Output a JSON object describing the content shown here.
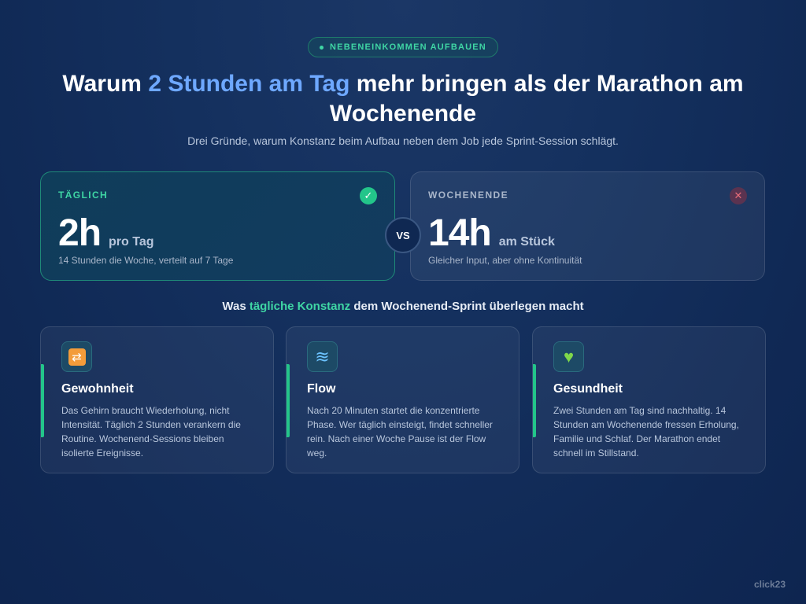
{
  "badge": {
    "label": "NEBENEINKOMMEN AUFBAUEN"
  },
  "headline": {
    "part1": "Warum ",
    "highlight": "2 Stunden am Tag",
    "part2": " mehr bringen als der Marathon am Wochenende"
  },
  "subtitle": "Drei Gründe, warum Konstanz beim Aufbau neben dem Job jede Sprint-Session schlägt.",
  "comparison": {
    "left": {
      "label": "TÄGLICH",
      "status_icon": "check-icon",
      "status_glyph": "✓",
      "value": "2h",
      "unit": "pro Tag",
      "description": "14 Stunden die Woche, verteilt auf 7 Tage",
      "accent_color": "#3fd6a4"
    },
    "vs_label": "VS",
    "right": {
      "label": "WOCHENENDE",
      "status_icon": "close-icon",
      "status_glyph": "✕",
      "value": "14h",
      "unit": "am Stück",
      "description": "Gleicher Input, aber ohne Kontinuität",
      "accent_color": "#e86d7a"
    }
  },
  "section": {
    "part1": "Was ",
    "highlight": "tägliche Konstanz",
    "part2": " dem Wochenend-Sprint überlegen macht"
  },
  "features": [
    {
      "icon": "repeat-icon",
      "glyph": "🔁",
      "title": "Gewohnheit",
      "text": "Das Gehirn braucht Wiederholung, nicht Intensität. Täglich 2 Stunden verankern die Routine. Wochenend-Sessions bleiben isolierte Ereignisse."
    },
    {
      "icon": "wave-icon",
      "glyph": "🌊",
      "title": "Flow",
      "text": "Nach 20 Minuten startet die konzentrierte Phase. Wer täglich einsteigt, findet schneller rein. Nach einer Woche Pause ist der Flow weg."
    },
    {
      "icon": "green-heart-icon",
      "glyph": "💚",
      "title": "Gesundheit",
      "text": "Zwei Stunden am Tag sind nachhaltig. 14 Stunden am Wochenende fressen Erholung, Familie und Schlaf. Der Marathon endet schnell im Stillstand."
    }
  ],
  "brand": "click23",
  "colors": {
    "accent_green": "#3fd6a4",
    "accent_blue": "#6ea8ff",
    "background": "#14305e"
  }
}
